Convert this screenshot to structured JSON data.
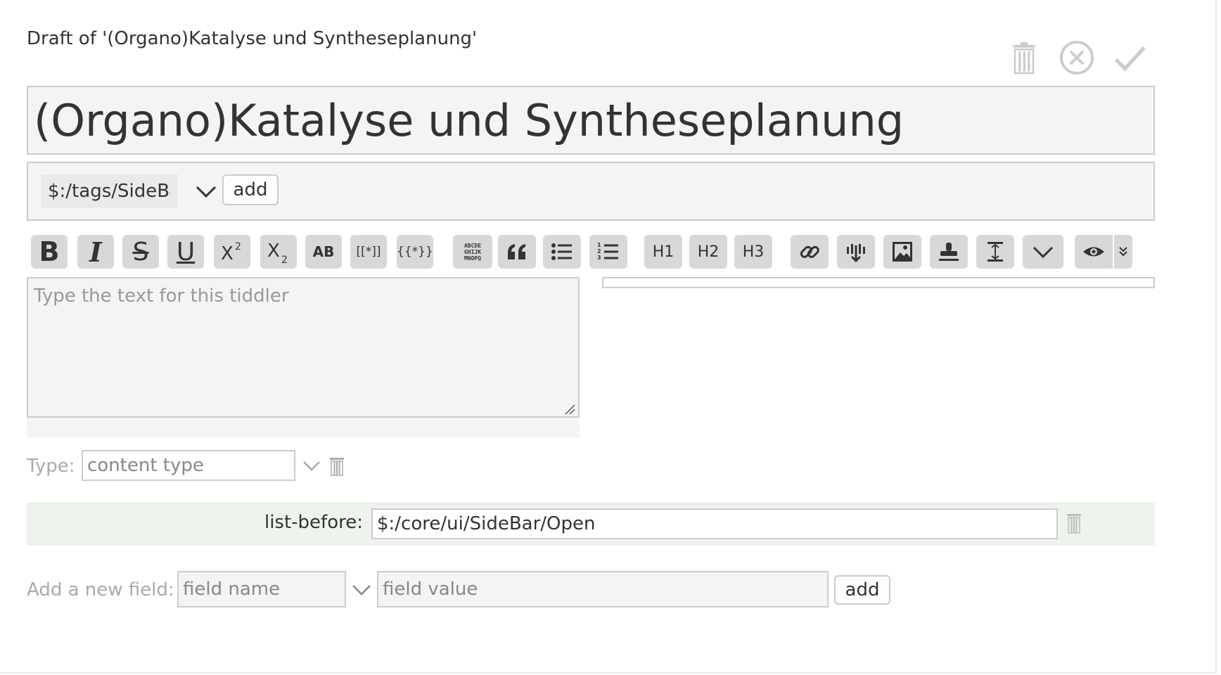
{
  "draft_title": "Draft of '(Organo)Katalyse und Syntheseplanung'",
  "title_value": "(Organo)Katalyse und Syntheseplanung",
  "controls": {
    "delete_icon": "trash-icon",
    "cancel_icon": "circle-x-icon",
    "save_icon": "check-icon"
  },
  "tags": {
    "input_value": "$:/tags/SideBar",
    "add_label": "add"
  },
  "toolbar": {
    "buttons": [
      {
        "name": "bold",
        "label": "B"
      },
      {
        "name": "italic",
        "label": "I"
      },
      {
        "name": "strikethrough",
        "label": "S"
      },
      {
        "name": "underline",
        "label": "U"
      },
      {
        "name": "superscript",
        "label": "X2"
      },
      {
        "name": "subscript",
        "label": "X2"
      },
      {
        "name": "smallcaps",
        "label": "AB"
      },
      {
        "name": "link-wiki",
        "label": "[[*]]"
      },
      {
        "name": "transclude",
        "label": "{{*}}"
      },
      {
        "name": "monospace",
        "label": "ABCDE GHIJK MNOPQ"
      },
      {
        "name": "quote",
        "label": "“"
      },
      {
        "name": "bullet-list",
        "label": ""
      },
      {
        "name": "numbered-list",
        "label": "1 2 3"
      },
      {
        "name": "heading-1",
        "label": "H1"
      },
      {
        "name": "heading-2",
        "label": "H2"
      },
      {
        "name": "heading-3",
        "label": "H3"
      },
      {
        "name": "link",
        "label": ""
      },
      {
        "name": "excise",
        "label": ""
      },
      {
        "name": "picture",
        "label": ""
      },
      {
        "name": "stamp",
        "label": ""
      },
      {
        "name": "line-width",
        "label": ""
      },
      {
        "name": "more",
        "label": ""
      },
      {
        "name": "preview",
        "label": ""
      },
      {
        "name": "preview-type",
        "label": ""
      }
    ]
  },
  "body": {
    "placeholder": "Type the text for this tiddler"
  },
  "type_field": {
    "label": "Type:",
    "placeholder": "content type"
  },
  "fields": [
    {
      "name": "list-before:",
      "value": "$:/core/ui/SideBar/Open"
    }
  ],
  "new_field": {
    "label": "Add a new field:",
    "name_placeholder": "field name",
    "value_placeholder": "field value",
    "add_label": "add"
  },
  "colors": {
    "icon_gray": "#cccccc",
    "button_bg": "#d8d8d8",
    "field_row_bg": "#eef3ee",
    "input_bg": "#f4f4f4"
  }
}
